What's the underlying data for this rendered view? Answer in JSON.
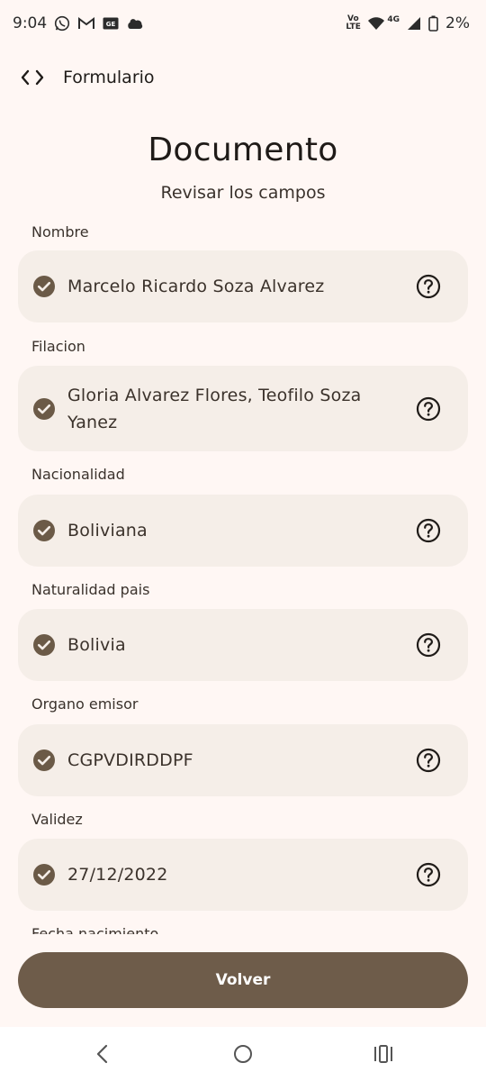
{
  "status_bar": {
    "time": "9:04",
    "battery": "2%",
    "network_lte": "Vo LTE",
    "network_4g": "4G",
    "left_icons": [
      "whatsapp-icon",
      "gmail-icon",
      "ge-icon",
      "cloud-icon"
    ],
    "right_icons": [
      "volte-icon",
      "wifi-icon",
      "signal-icon",
      "battery-icon"
    ]
  },
  "app_bar": {
    "icon": "code-icon",
    "title": "Formulario"
  },
  "header": {
    "title": "Documento",
    "subtitle": "Revisar los campos"
  },
  "fields": [
    {
      "label": "Nombre",
      "value": "Marcelo Ricardo Soza Alvarez"
    },
    {
      "label": "Filacion",
      "value": "Gloria Alvarez Flores, Teofilo Soza Yanez"
    },
    {
      "label": "Nacionalidad",
      "value": "Boliviana"
    },
    {
      "label": "Naturalidad pais",
      "value": "Bolivia"
    },
    {
      "label": "Organo emisor",
      "value": "CGPVDIRDDPF"
    },
    {
      "label": "Validez",
      "value": "27/12/2022"
    },
    {
      "label": "Fecha nacimiento",
      "value": ""
    }
  ],
  "actions": {
    "back_label": "Volver"
  },
  "colors": {
    "background": "#fff7f4",
    "card": "#f5eee8",
    "primary": "#6e5c4a",
    "icon": "#6b5a47"
  }
}
